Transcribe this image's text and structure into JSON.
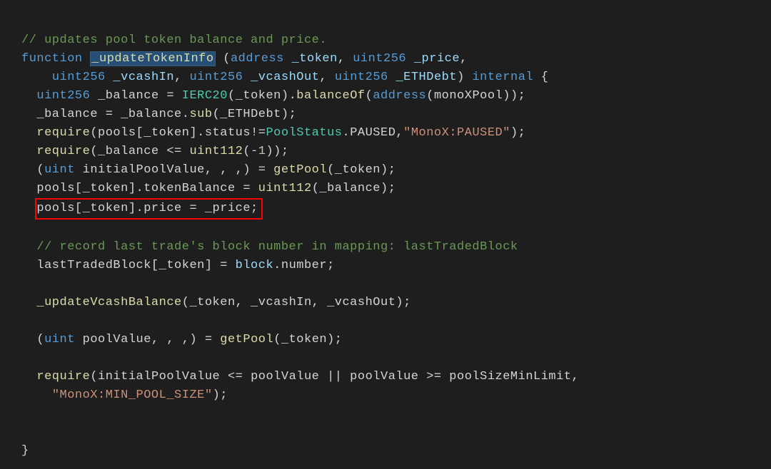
{
  "c01": "// updates pool token balance and price.",
  "l02_kw": "function",
  "l02_fn": "_updateTokenInfo",
  "l02_p1": " (",
  "l02_tp1": "address",
  "l02_v1": " _token",
  "l02_s1": ", ",
  "l02_tp2": "uint256",
  "l02_v2": " _price",
  "l02_s2": ",",
  "l03_tp1": "uint256",
  "l03_v1": " _vcashIn",
  "l03_s1": ", ",
  "l03_tp2": "uint256",
  "l03_v2": " _vcashOut",
  "l03_s2": ", ",
  "l03_tp3": "uint256",
  "l03_v3": " _ETHDebt",
  "l03_p2": ") ",
  "l03_kw": "internal",
  "l03_b": " {",
  "l04_tp": "uint256",
  "l04_a": " _balance = ",
  "l04_cls": "IERC20",
  "l04_b": "(_token).",
  "l04_fn": "balanceOf",
  "l04_c": "(",
  "l04_kw": "address",
  "l04_d": "(monoXPool));",
  "l05": "_balance = _balance.",
  "l05_fn": "sub",
  "l05_b": "(_ETHDebt);",
  "l06_f": "require",
  "l06_a": "(pools[_token].status!=",
  "l06_cls": "PoolStatus",
  "l06_b": ".PAUSED,",
  "l06_str": "\"MonoX:PAUSED\"",
  "l06_c": ");",
  "l07_f": "require",
  "l07_a": "(_balance <= ",
  "l07_fn": "uint112",
  "l07_b": "(-",
  "l07_n": "1",
  "l07_c": "));",
  "l08_a": "(",
  "l08_kw": "uint",
  "l08_b": " initialPoolValue, , ,) = ",
  "l08_fn": "getPool",
  "l08_c": "(_token);",
  "l09_a": "pools[_token].tokenBalance = ",
  "l09_fn": "uint112",
  "l09_b": "(_balance);",
  "l10": "pools[_token].price = _price;",
  "c11": "// record last trade's block number in mapping: lastTradedBlock",
  "l12_a": "lastTradedBlock[_token] = ",
  "l12_v": "block",
  "l12_b": ".number;",
  "l13_fn": "_updateVcashBalance",
  "l13_a": "(_token, _vcashIn, _vcashOut);",
  "l14_a": "(",
  "l14_kw": "uint",
  "l14_b": " poolValue, , ,) = ",
  "l14_fn": "getPool",
  "l14_c": "(_token);",
  "l15_f": "require",
  "l15_a": "(initialPoolValue <= poolValue || poolValue >= poolSizeMinLimit,",
  "l16_str": "\"MonoX:MIN_POOL_SIZE\"",
  "l16_a": ");",
  "l17": "}"
}
